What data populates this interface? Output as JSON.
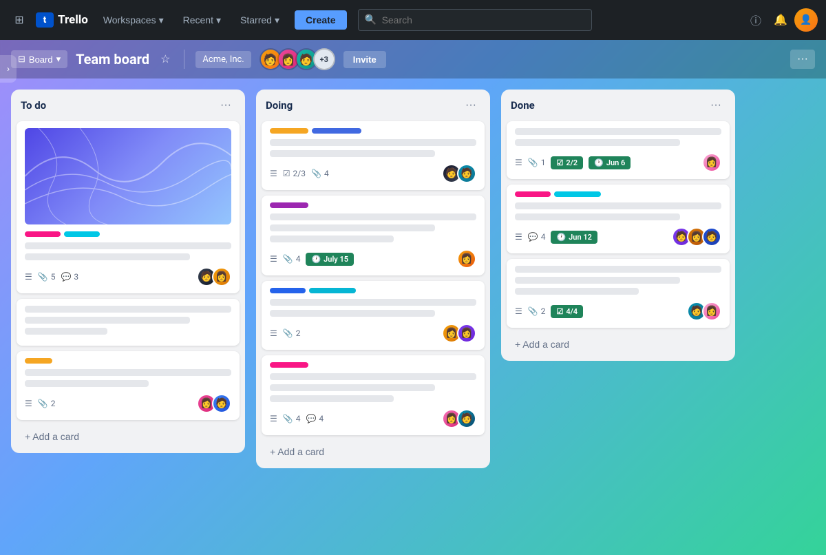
{
  "navbar": {
    "logo_text": "Trello",
    "workspaces_label": "Workspaces",
    "recent_label": "Recent",
    "starred_label": "Starred",
    "create_label": "Create",
    "search_placeholder": "Search",
    "chevron": "▾",
    "info_icon": "ⓘ",
    "notification_icon": "🔔"
  },
  "board_header": {
    "view_label": "Board",
    "title": "Team board",
    "workspace_label": "Acme, Inc.",
    "extra_members": "+3",
    "invite_label": "Invite",
    "more_icon": "···"
  },
  "lists": [
    {
      "id": "todo",
      "title": "To do",
      "cards": [
        {
          "id": "card-1",
          "has_image": true,
          "labels": [
            "pink",
            "teal"
          ],
          "text_lines": [
            "full",
            "medium"
          ],
          "footer": {
            "desc": true,
            "attachments": 5,
            "comments": 3
          },
          "avatars": [
            "dark-female",
            "yellow-female"
          ],
          "has_avatars": true
        },
        {
          "id": "card-2",
          "has_image": false,
          "labels": [],
          "text_lines": [
            "full",
            "medium",
            "xshort"
          ],
          "footer": {},
          "avatars": [],
          "has_avatars": false,
          "empty_spacer": true
        },
        {
          "id": "card-3",
          "has_image": false,
          "labels": [
            "yellow"
          ],
          "text_lines": [
            "full",
            "short"
          ],
          "footer": {
            "desc": true,
            "attachments": 2
          },
          "avatars": [
            "pink-female",
            "blue-male"
          ],
          "has_avatars": true
        }
      ],
      "add_card_label": "+ Add a card"
    },
    {
      "id": "doing",
      "title": "Doing",
      "cards": [
        {
          "id": "card-4",
          "has_image": false,
          "labels": [
            "yellow-wide",
            "blue-wide"
          ],
          "text_lines": [
            "full",
            "medium"
          ],
          "footer": {
            "desc": true,
            "checklist": "2/3",
            "attachments": 4
          },
          "avatars": [
            "dark-female2",
            "teal-male"
          ],
          "has_avatars": true
        },
        {
          "id": "card-5",
          "has_image": false,
          "labels": [
            "purple"
          ],
          "text_lines": [
            "full",
            "medium",
            "short"
          ],
          "footer": {
            "desc": true,
            "attachments": 4,
            "date": "July 15"
          },
          "avatars": [
            "orange-female"
          ],
          "has_avatars": true
        },
        {
          "id": "card-6",
          "has_image": false,
          "labels": [
            "blue-wide2",
            "cyan-wide"
          ],
          "text_lines": [
            "full",
            "medium"
          ],
          "footer": {
            "desc": true,
            "attachments": 2
          },
          "avatars": [
            "orange-female2",
            "purple-female"
          ],
          "has_avatars": true
        },
        {
          "id": "card-7",
          "has_image": false,
          "labels": [
            "pink-wide"
          ],
          "text_lines": [
            "full",
            "medium",
            "short"
          ],
          "footer": {
            "desc": true,
            "attachments": 4,
            "comments": 4
          },
          "avatars": [
            "pink-female2",
            "dark-male"
          ],
          "has_avatars": true
        }
      ],
      "add_card_label": "+ Add a card"
    },
    {
      "id": "done",
      "title": "Done",
      "cards": [
        {
          "id": "card-8",
          "has_image": false,
          "labels": [],
          "text_lines": [
            "full",
            "medium"
          ],
          "footer": {
            "desc": true,
            "attachments": 1,
            "checklist_badge": "2/2",
            "date_badge": "Jun 6"
          },
          "avatars": [
            "pink-female3"
          ],
          "has_avatars": true
        },
        {
          "id": "card-9",
          "has_image": false,
          "labels": [
            "pink-wide2",
            "teal-wide"
          ],
          "text_lines": [
            "full",
            "medium"
          ],
          "footer": {
            "desc": true,
            "comments": 4,
            "date_badge": "Jun 12"
          },
          "avatars": [
            "purple-male",
            "yellow-female2",
            "blue-male2"
          ],
          "has_avatars": true
        },
        {
          "id": "card-10",
          "has_image": false,
          "labels": [],
          "text_lines": [
            "full",
            "medium",
            "short"
          ],
          "footer": {
            "desc": true,
            "attachments": 2,
            "checklist_badge": "4/4"
          },
          "avatars": [
            "teal-male2",
            "pink-female4"
          ],
          "has_avatars": true
        }
      ],
      "add_card_label": "+ Add a card"
    }
  ]
}
